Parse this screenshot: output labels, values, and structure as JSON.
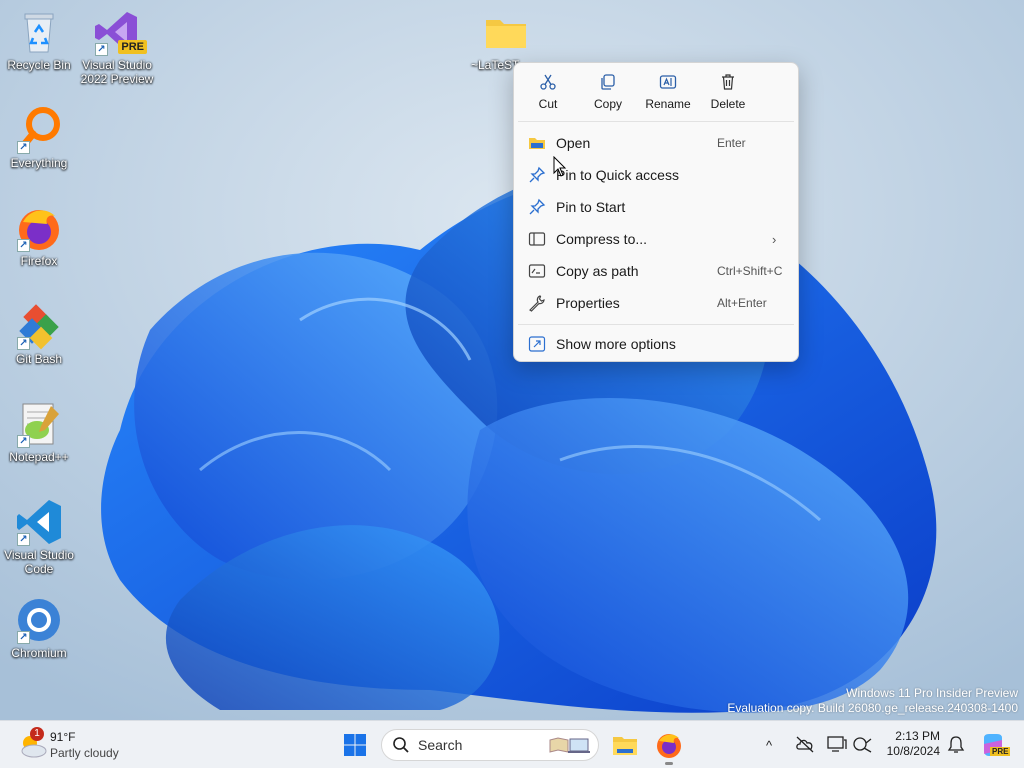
{
  "desktop": {
    "icons": [
      {
        "label": "Recycle Bin",
        "icon": "recycle-bin-icon"
      },
      {
        "label": "Visual Studio 2022 Preview",
        "icon": "visual-studio-icon",
        "badge": "PRE"
      },
      {
        "label": "Everything",
        "icon": "everything-search-icon"
      },
      {
        "label": "Firefox",
        "icon": "firefox-icon"
      },
      {
        "label": "Git Bash",
        "icon": "git-bash-icon"
      },
      {
        "label": "Notepad++",
        "icon": "notepad-plus-plus-icon"
      },
      {
        "label": "Visual Studio Code",
        "icon": "vscode-icon"
      },
      {
        "label": "Chromium",
        "icon": "chromium-icon"
      }
    ],
    "folder": {
      "label": "~LaTeST",
      "icon": "folder-icon"
    },
    "shortcut_arrow": "↗"
  },
  "context_menu": {
    "quick_actions": [
      {
        "label": "Cut",
        "icon": "scissors-icon"
      },
      {
        "label": "Copy",
        "icon": "copy-icon"
      },
      {
        "label": "Rename",
        "icon": "rename-icon"
      },
      {
        "label": "Delete",
        "icon": "trash-icon"
      }
    ],
    "items": [
      {
        "label": "Open",
        "shortcut": "Enter",
        "icon": "open-folder-icon"
      },
      {
        "label": "Pin to Quick access",
        "shortcut": "",
        "icon": "pin-icon"
      },
      {
        "label": "Pin to Start",
        "shortcut": "",
        "icon": "pin-icon"
      },
      {
        "label": "Compress to...",
        "shortcut": "",
        "icon": "archive-icon",
        "submenu": "›"
      },
      {
        "label": "Copy as path",
        "shortcut": "Ctrl+Shift+C",
        "icon": "path-icon"
      },
      {
        "label": "Properties",
        "shortcut": "Alt+Enter",
        "icon": "wrench-icon"
      }
    ],
    "more": {
      "label": "Show more options",
      "icon": "more-options-icon"
    }
  },
  "watermark": {
    "line1": "Windows 11 Pro Insider Preview",
    "line2": "Evaluation copy. Build 26080.ge_release.240308-1400"
  },
  "taskbar": {
    "weather": {
      "temp": "91°F",
      "condition": "Partly cloudy",
      "badge": "1"
    },
    "search_placeholder": "Search",
    "clock": {
      "time": "2:13 PM",
      "date": "10/8/2024"
    },
    "tray_chevron": "^",
    "copilot_badge": "PRE"
  },
  "colors": {
    "accent": "#0a5fd8",
    "menu_bg": "#f9f9f9",
    "taskbar_bg": "#eef1f5"
  }
}
